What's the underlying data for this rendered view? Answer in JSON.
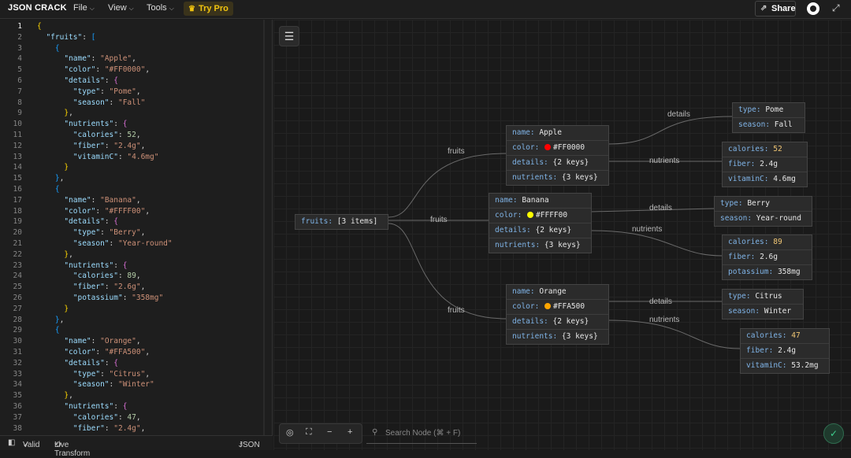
{
  "app": {
    "logo": "JSON CRACK"
  },
  "menu": {
    "file": "File",
    "view": "View",
    "tools": "Tools",
    "try_pro": "Try Pro",
    "share": "Share"
  },
  "icons": {
    "crown": "crown-icon",
    "share": "share-icon",
    "github": "github-icon",
    "fullscreen": "fullscreen-icon",
    "menu": "hamburger-icon",
    "shield": "shield-check-icon"
  },
  "editor": {
    "lines": [
      "{",
      "  \"fruits\": [",
      "    {",
      "      \"name\": \"Apple\",",
      "      \"color\": \"#FF0000\",",
      "      \"details\": {",
      "        \"type\": \"Pome\",",
      "        \"season\": \"Fall\"",
      "      },",
      "      \"nutrients\": {",
      "        \"calories\": 52,",
      "        \"fiber\": \"2.4g\",",
      "        \"vitaminC\": \"4.6mg\"",
      "      }",
      "    },",
      "    {",
      "      \"name\": \"Banana\",",
      "      \"color\": \"#FFFF00\",",
      "      \"details\": {",
      "        \"type\": \"Berry\",",
      "        \"season\": \"Year-round\"",
      "      },",
      "      \"nutrients\": {",
      "        \"calories\": 89,",
      "        \"fiber\": \"2.6g\",",
      "        \"potassium\": \"358mg\"",
      "      }",
      "    },",
      "    {",
      "      \"name\": \"Orange\",",
      "      \"color\": \"#FFA500\",",
      "      \"details\": {",
      "        \"type\": \"Citrus\",",
      "        \"season\": \"Winter\"",
      "      },",
      "      \"nutrients\": {",
      "        \"calories\": 47,",
      "        \"fiber\": \"2.4g\","
    ]
  },
  "status": {
    "valid": "Valid",
    "transform": "Live Transform",
    "format": "JSON"
  },
  "graph": {
    "root": {
      "key": "fruits",
      "value": "[3 items]"
    },
    "edge_label_fruits": "fruits",
    "edge_label_details": "details",
    "edge_label_nutrients": "nutrients",
    "items": [
      {
        "name": "Apple",
        "color": "#FF0000",
        "details_summary": "{2 keys}",
        "nutrients_summary": "{3 keys}",
        "details": {
          "type": "Pome",
          "season": "Fall"
        },
        "nutrients": [
          {
            "key": "calories",
            "value": "52"
          },
          {
            "key": "fiber",
            "value": "2.4g"
          },
          {
            "key": "vitaminC",
            "value": "4.6mg"
          }
        ]
      },
      {
        "name": "Banana",
        "color": "#FFFF00",
        "details_summary": "{2 keys}",
        "nutrients_summary": "{3 keys}",
        "details": {
          "type": "Berry",
          "season": "Year-round"
        },
        "nutrients": [
          {
            "key": "calories",
            "value": "89"
          },
          {
            "key": "fiber",
            "value": "2.6g"
          },
          {
            "key": "potassium",
            "value": "358mg"
          }
        ]
      },
      {
        "name": "Orange",
        "color": "#FFA500",
        "details_summary": "{2 keys}",
        "nutrients_summary": "{3 keys}",
        "details": {
          "type": "Citrus",
          "season": "Winter"
        },
        "nutrients": [
          {
            "key": "calories",
            "value": "47"
          },
          {
            "key": "fiber",
            "value": "2.4g"
          },
          {
            "key": "vitaminC",
            "value": "53.2mg"
          }
        ]
      }
    ],
    "search_placeholder": "Search Node (⌘ + F)"
  }
}
